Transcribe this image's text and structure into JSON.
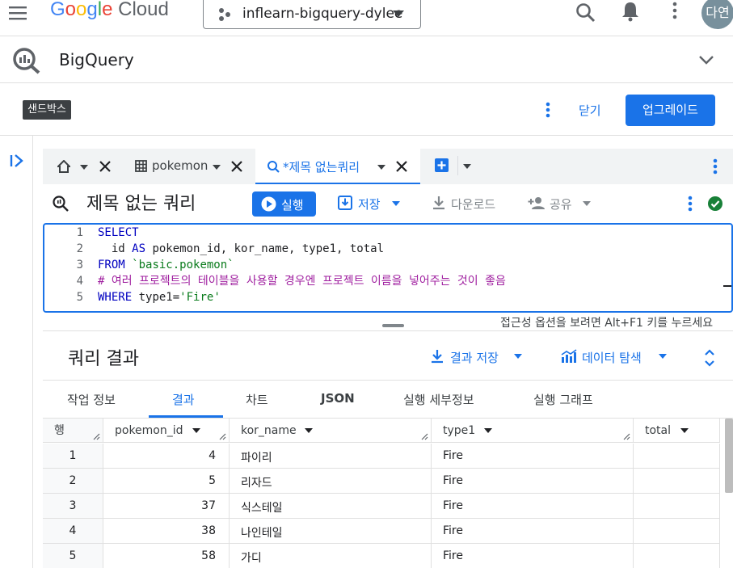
{
  "topbar": {
    "logo_google": "Google",
    "logo_cloud": "Cloud",
    "project": "inflearn-bigquery-dylee",
    "avatar": "다연"
  },
  "product": {
    "title": "BigQuery"
  },
  "sandbox": {
    "badge": "샌드박스",
    "close": "닫기",
    "upgrade": "업그레이드"
  },
  "tabs": {
    "pokemon": "pokemon",
    "query": "*제목 없는쿼리"
  },
  "editor": {
    "title": "제목 없는 쿼리",
    "run": "실행",
    "save": "저장",
    "download": "다운로드",
    "share": "공유",
    "lines": [
      {
        "n": "1",
        "parts": [
          {
            "c": "kw",
            "t": "SELECT"
          }
        ]
      },
      {
        "n": "2",
        "parts": [
          {
            "c": "plain",
            "t": "  id "
          },
          {
            "c": "kw",
            "t": "AS"
          },
          {
            "c": "plain",
            "t": " pokemon_id, kor_name, type1, total"
          }
        ]
      },
      {
        "n": "3",
        "parts": [
          {
            "c": "kw",
            "t": "FROM"
          },
          {
            "c": "plain",
            "t": " "
          },
          {
            "c": "str",
            "t": "`basic.pokemon`"
          }
        ]
      },
      {
        "n": "4",
        "parts": [
          {
            "c": "cmt",
            "t": "# 여러 프로젝트의 테이블을 사용할 경우엔 프로젝트 이름을 넣어주는 것이 좋음"
          }
        ]
      },
      {
        "n": "5",
        "parts": [
          {
            "c": "kw",
            "t": "WHERE"
          },
          {
            "c": "plain",
            "t": " type1="
          },
          {
            "c": "str",
            "t": "'Fire'"
          }
        ]
      }
    ],
    "a11y_hint": "접근성 옵션을 보려면 Alt+F1 키를 누르세요"
  },
  "results": {
    "title": "쿼리 결과",
    "save_results": "결과 저장",
    "explore": "데이터 탐색",
    "tabs": [
      "작업 정보",
      "결과",
      "차트",
      "JSON",
      "실행 세부정보",
      "실행 그래프"
    ],
    "active_tab": "결과",
    "columns": {
      "row": "행",
      "c1": "pokemon_id",
      "c2": "kor_name",
      "c3": "type1",
      "c4": "total"
    },
    "rows": [
      {
        "row": "1",
        "pokemon_id": "4",
        "kor_name": "파이리",
        "type1": "Fire",
        "total": ""
      },
      {
        "row": "2",
        "pokemon_id": "5",
        "kor_name": "리자드",
        "type1": "Fire",
        "total": ""
      },
      {
        "row": "3",
        "pokemon_id": "37",
        "kor_name": "식스테일",
        "type1": "Fire",
        "total": ""
      },
      {
        "row": "4",
        "pokemon_id": "38",
        "kor_name": "나인테일",
        "type1": "Fire",
        "total": ""
      },
      {
        "row": "5",
        "pokemon_id": "58",
        "kor_name": "가디",
        "type1": "Fire",
        "total": ""
      }
    ]
  }
}
